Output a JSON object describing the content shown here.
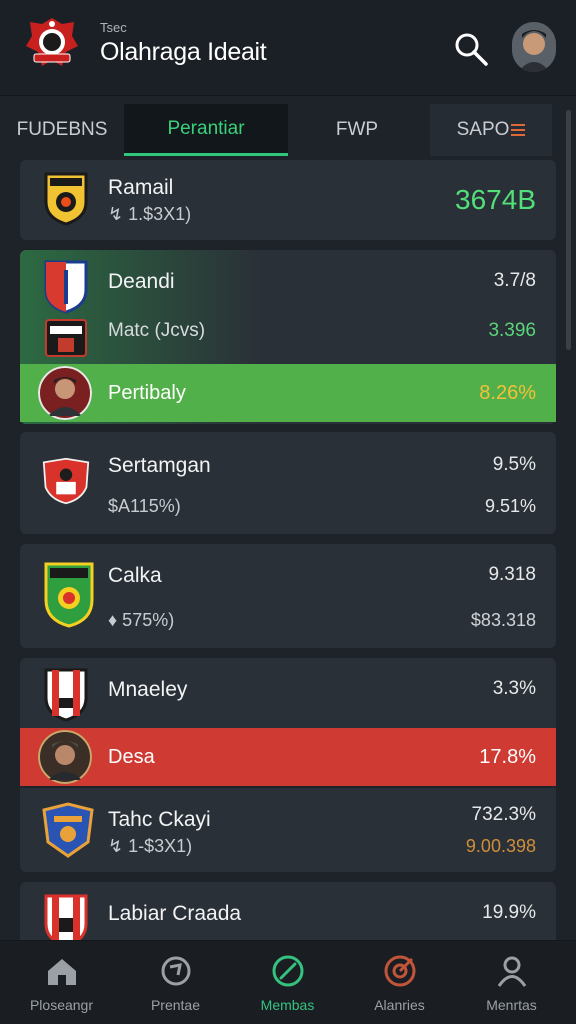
{
  "header": {
    "overline": "Tsec",
    "title": "Olahraga Ideait",
    "logo_icon": "club-crest-logo",
    "search_icon": "search-icon",
    "avatar_icon": "user-avatar"
  },
  "tabs": [
    {
      "label": "FUDEBNS"
    },
    {
      "label": "Perantiar"
    },
    {
      "label": "FWP"
    },
    {
      "label": "SAPO"
    }
  ],
  "rows": [
    {
      "name": "Ramail",
      "sub": "↯ 1.$3X1)",
      "value": "3674B"
    },
    {
      "name": "Deandi",
      "value": "3.7/8"
    },
    {
      "name": "Matc (Jcvs)",
      "value": "3.396"
    },
    {
      "name": "Pertibaly",
      "value": "8.26%"
    },
    {
      "name": "Sertamgan",
      "value": "9.5%"
    },
    {
      "name": "",
      "sub": "$A115%)",
      "value": "9.51%"
    },
    {
      "name": "Calka",
      "value": "9.318"
    },
    {
      "name": "",
      "sub": "♦ 575%)",
      "value": "$83.318"
    },
    {
      "name": "Mnaeley",
      "value": "3.3%"
    },
    {
      "name": "Desa",
      "value": "17.8%"
    },
    {
      "name": "Tahc Ckayi",
      "value": "732.3%"
    },
    {
      "name": "",
      "sub": "↯ 1-$3X1)",
      "value": "9.00.398"
    },
    {
      "name": "Labiar Craada",
      "value": "19.9%"
    }
  ],
  "nav": [
    {
      "label": "Ploseangr",
      "icon": "home-icon"
    },
    {
      "label": "Prentae",
      "icon": "refresh-icon"
    },
    {
      "label": "Membas",
      "icon": "compass-icon"
    },
    {
      "label": "Alanries",
      "icon": "target-icon"
    },
    {
      "label": "Menrtas",
      "icon": "person-icon"
    }
  ],
  "colors": {
    "accent_green": "#35c27f",
    "value_green": "#52e07a",
    "highlight_green": "#4caf50",
    "highlight_red": "#cf3a33",
    "gold": "#f2c13a"
  }
}
